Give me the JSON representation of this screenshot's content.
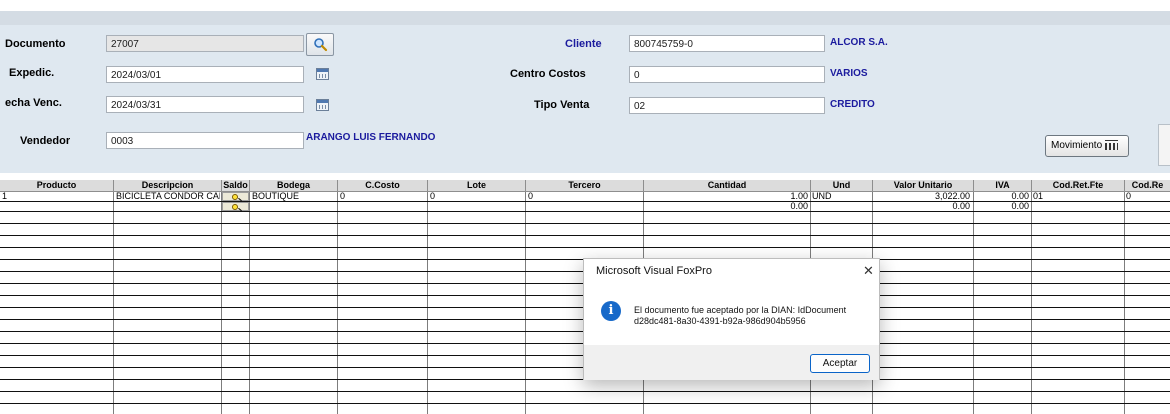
{
  "form": {
    "documento": {
      "label": "Documento",
      "value": "27007"
    },
    "expedic": {
      "label": "Expedic.",
      "value": "2024/03/01"
    },
    "fecha_venc": {
      "label": "echa Venc.",
      "value": "2024/03/31"
    },
    "vendedor": {
      "label": "Vendedor",
      "value": "0003",
      "name": "ARANGO LUIS FERNANDO"
    },
    "cliente": {
      "label": "Cliente",
      "value": "800745759-0",
      "name": "ALCOR S.A."
    },
    "centro_costos": {
      "label": "Centro Costos",
      "value": "0",
      "name": "VARIOS"
    },
    "tipo_venta": {
      "label": "Tipo Venta",
      "value": "02",
      "name": "CREDITO"
    },
    "movimiento_label": "Movimiento"
  },
  "grid": {
    "headers": [
      "Producto",
      "Descripcion",
      "Saldo",
      "Bodega",
      "C.Costo",
      "Lote",
      "Tercero",
      "Cantidad",
      "Und",
      "Valor Unitario",
      "IVA",
      "Cod.Ret.Fte",
      "Cod.Re"
    ],
    "rows": [
      {
        "producto": "1",
        "descripcion": "BICICLETA CONDOR CAME",
        "bodega": "BOUTIQUE",
        "ccosto": "0",
        "lote": "0",
        "tercero": "0",
        "cantidad": "1.00",
        "und": "UND",
        "valor_unitario": "3,022.00",
        "iva": "0.00",
        "cod_ret_fte": "01",
        "cod_re": "0"
      },
      {
        "producto": "",
        "descripcion": "",
        "bodega": "",
        "ccosto": "",
        "lote": "",
        "tercero": "",
        "cantidad": "0.00",
        "und": "",
        "valor_unitario": "0.00",
        "iva": "0.00",
        "cod_ret_fte": "",
        "cod_re": ""
      }
    ]
  },
  "dialog": {
    "title": "Microsoft Visual FoxPro",
    "close": "✕",
    "message_line1": "El documento fue aceptado por la DIAN: IdDocument",
    "message_line2": "d28dc481-8a30-4391-b92a-986d904b5956",
    "button": "Aceptar",
    "icon": "info-icon"
  },
  "colors": {
    "form_bg": "#dfe8f0",
    "label_blue": "#1b1b9e",
    "dialog_accent": "#1769c9"
  }
}
